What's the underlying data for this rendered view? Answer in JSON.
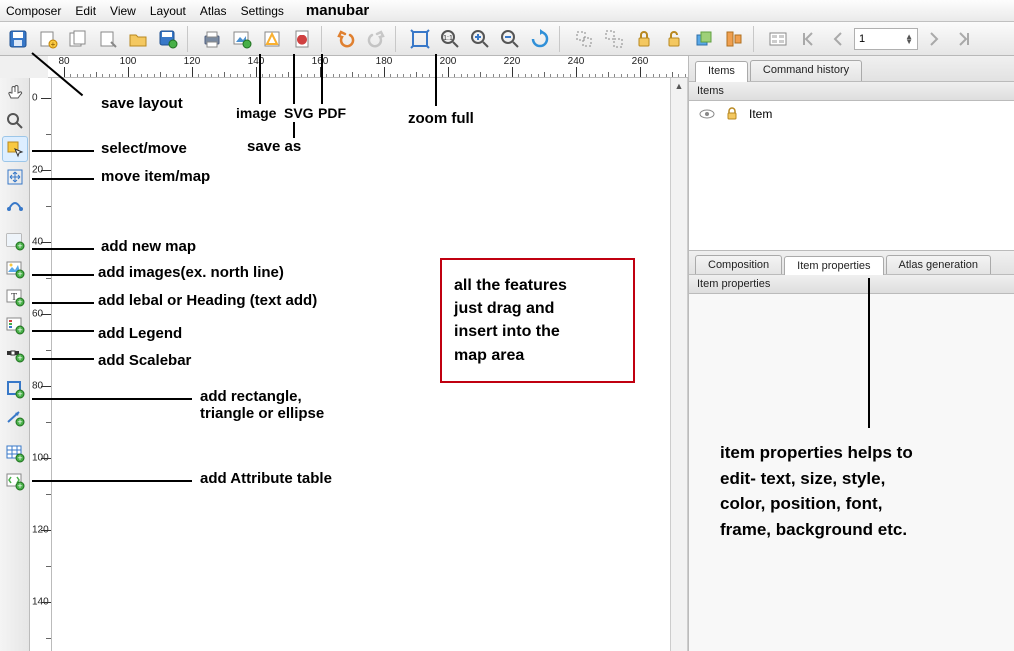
{
  "menubar": {
    "items": [
      "Composer",
      "Edit",
      "View",
      "Layout",
      "Atlas",
      "Settings"
    ],
    "annotation": "manubar"
  },
  "toolbar": {
    "spin_value": "1"
  },
  "ruler_h": {
    "start": 90,
    "step": 20,
    "labels": [
      100,
      120,
      140,
      160,
      180,
      200,
      220,
      240,
      260
    ]
  },
  "ruler_v": {
    "labels": [
      20,
      40,
      60,
      80,
      100,
      120,
      140
    ]
  },
  "right": {
    "tabs_top": [
      "Items",
      "Command history"
    ],
    "items_header": "Items",
    "item_label": "Item",
    "tabs_bottom": [
      "Composition",
      "Item properties",
      "Atlas generation"
    ],
    "props_header": "Item properties"
  },
  "annotations": {
    "save_layout": "save layout",
    "image": "image",
    "svg": "SVG",
    "pdf": "PDF",
    "save_as": "save as",
    "zoom_full": "zoom full",
    "select_move": "select/move",
    "move_item": "move item/map",
    "add_map": "add new map",
    "add_images": "add images(ex. north line)",
    "add_label": "add lebal or Heading (text add)",
    "add_legend": "add Legend",
    "add_scalebar": "add Scalebar",
    "add_shape": "add rectangle,\ntriangle or ellipse",
    "add_attr": "add Attribute table",
    "redbox": "all the features\njust drag and\ninsert into the\nmap area",
    "item_props_desc": "item properties helps to\nedit- text, size, style,\ncolor, position, font,\nframe, background etc."
  }
}
